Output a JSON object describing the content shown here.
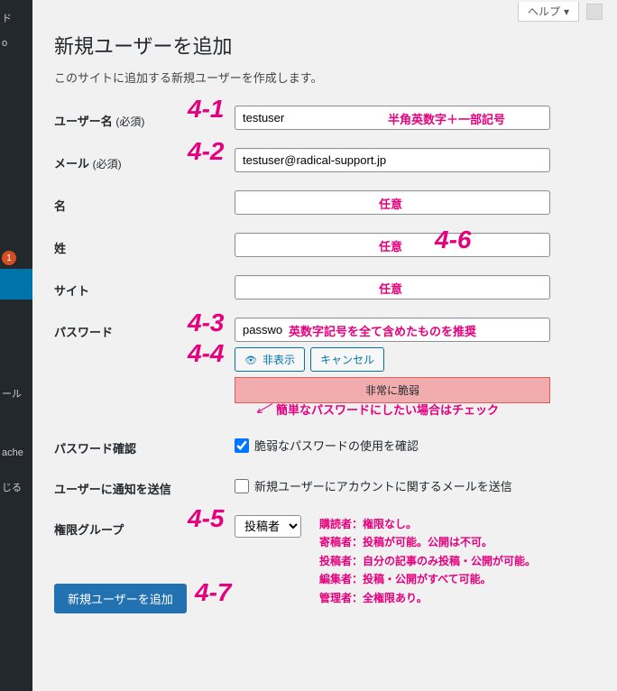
{
  "topbar": {
    "help_label": "ヘルプ"
  },
  "page": {
    "title": "新規ユーザーを追加",
    "description": "このサイトに追加する新規ユーザーを作成します。"
  },
  "sidebar": {
    "badge": "1",
    "items": [
      "ド",
      "o",
      "ール",
      "ache",
      "じる"
    ]
  },
  "fields": {
    "username": {
      "label": "ユーザー名",
      "req": "(必須)",
      "value": "testuser"
    },
    "email": {
      "label": "メール",
      "req": "(必須)",
      "value": "testuser@radical-support.jp"
    },
    "first_name": {
      "label": "名",
      "value": ""
    },
    "last_name": {
      "label": "姓",
      "value": ""
    },
    "website": {
      "label": "サイト",
      "value": ""
    },
    "password": {
      "label": "パスワード",
      "value": "passwo"
    },
    "password_hide": "非表示",
    "password_cancel": "キャンセル",
    "password_strength": "非常に脆弱",
    "password_confirm": {
      "label": "パスワード確認",
      "checkbox_label": "脆弱なパスワードの使用を確認"
    },
    "send_notification": {
      "label": "ユーザーに通知を送信",
      "checkbox_label": "新規ユーザーにアカウントに関するメールを送信"
    },
    "role": {
      "label": "権限グループ",
      "selected": "投稿者"
    }
  },
  "submit_label": "新規ユーザーを追加",
  "annotations": {
    "n41": "4-1",
    "n42": "4-2",
    "n43": "4-3",
    "n44": "4-4",
    "n45": "4-5",
    "n46": "4-6",
    "n47": "4-7",
    "username_hint": "半角英数字＋一部記号",
    "optional": "任意",
    "pw_hint": "英数字記号を全て含めたものを推奨",
    "weak_check_hint": "簡単なパスワードにしたい場合はチェック",
    "role_desc": {
      "subscriber": "購読者：権限なし。",
      "contributor": "寄稿者：投稿が可能。公開は不可。",
      "author": "投稿者：自分の記事のみ投稿・公開が可能。",
      "editor": "編集者：投稿・公開がすべて可能。",
      "admin": "管理者：全権限あり。"
    }
  }
}
